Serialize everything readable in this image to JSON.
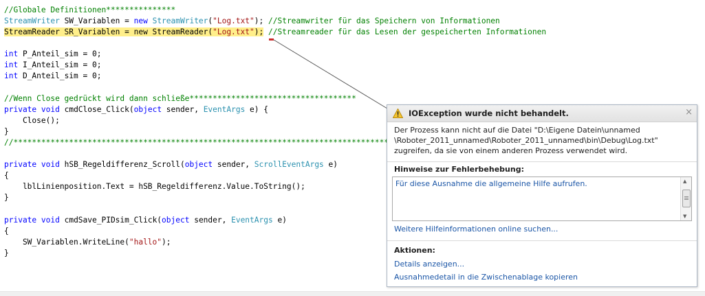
{
  "code": {
    "lines": [
      "//Globale Definitionen***************",
      "StreamWriter SW_Variablen = new StreamWriter(\"Log.txt\"); //Streamwriter für das Speichern von Informationen",
      "StreamReader SR_Variablen = new StreamReader(\"Log.txt\"); //Streamreader für das Lesen der gespeicherten Informationen",
      "int P_Anteil_sim = 0;",
      "int I_Anteil_sim = 0;",
      "int D_Anteil_sim = 0;",
      "//Wenn Close gedrückt wird dann schließe************************************",
      "private void cmdClose_Click(object sender, EventArgs e) {",
      "    Close();",
      "}",
      "//************************************************************************************",
      "private void hSB_Regeldifferenz_Scroll(object sender, ScrollEventArgs e)",
      "{",
      "    lblLinienposition.Text = hSB_Regeldifferenz.Value.ToString();",
      "}",
      "private void cmdSave_PIDsim_Click(object sender, EventArgs e)",
      "{",
      "    SW_Variablen.WriteLine(\"hallo\");",
      "}"
    ]
  },
  "exception_popup": {
    "title": "IOException wurde nicht behandelt.",
    "message": "Der Prozess kann nicht auf die Datei \"D:\\Eigene Datein\\unnamed \\Roboter_2011_unnamed\\Roboter_2011_unnamed\\bin\\Debug\\Log.txt\" zugreifen, da sie von einem anderen Prozess verwendet wird.",
    "hints_heading": "Hinweise zur Fehlerbehebung:",
    "hint_item": "Für diese Ausnahme die allgemeine Hilfe aufrufen.",
    "online_help_link": "Weitere Hilfeinformationen online suchen...",
    "actions_heading": "Aktionen:",
    "action_details": "Details anzeigen...",
    "action_copy": "Ausnahmedetail in die Zwischenablage kopieren",
    "close_glyph": "×",
    "icon": "warning-icon"
  },
  "colors": {
    "keyword": "#0000ff",
    "type": "#2b91af",
    "string": "#a31515",
    "comment": "#008000",
    "highlight": "#ffef8a",
    "link": "#1a55a6"
  }
}
